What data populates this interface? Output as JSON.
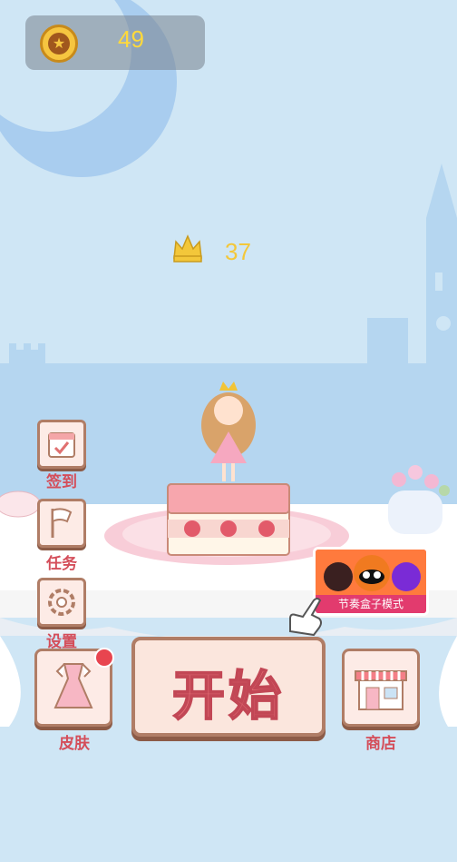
{
  "hud": {
    "coin_count": "49",
    "crown_count": "37"
  },
  "side_menu": {
    "checkin_label": "签到",
    "tasks_label": "任务",
    "settings_label": "设置"
  },
  "bottom_bar": {
    "skin_label": "皮肤",
    "start_label": "开始",
    "shop_label": "商店"
  },
  "ad_banner": {
    "label": "节奏盒子模式"
  },
  "colors": {
    "sky": "#cfe6f5",
    "accent_text": "#d44e5a",
    "gold": "#f3c73a"
  }
}
